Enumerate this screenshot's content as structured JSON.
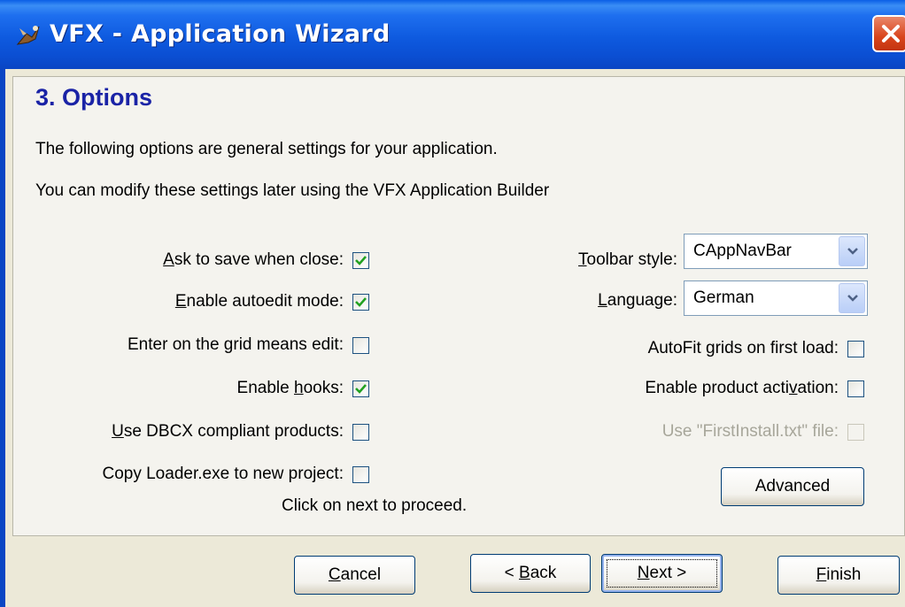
{
  "window": {
    "title": "VFX - Application Wizard"
  },
  "page": {
    "heading": "3. Options",
    "intro1": "The following options are general settings for your application.",
    "intro2": "You can modify these settings later using the VFX Application Builder",
    "footer_hint": "Click on next to proceed."
  },
  "left_options": [
    {
      "pre": "",
      "key": "A",
      "post": "sk to save when close:",
      "checked": true
    },
    {
      "pre": "",
      "key": "E",
      "post": "nable autoedit mode:",
      "checked": true
    },
    {
      "pre": "Enter on the ",
      "key": "g",
      "post": "rid means edit:",
      "checked": false
    },
    {
      "pre": "Enable ",
      "key": "h",
      "post": "ooks:",
      "checked": true
    },
    {
      "pre": "",
      "key": "U",
      "post": "se DBCX compliant products:",
      "checked": false
    },
    {
      "pre": "",
      "key": "",
      "post": "Copy Loader.exe to new project:",
      "checked": false
    }
  ],
  "right_options": {
    "toolbar_style": {
      "key": "T",
      "post": "oolbar style:",
      "value": "CAppNavBar"
    },
    "language": {
      "key": "L",
      "post": "anguage:",
      "value": "German"
    },
    "autofit": {
      "label": "AutoFit  grids on first load:",
      "checked": false
    },
    "activation": {
      "label": "Enable  product acti",
      "key": "v",
      "post": "ation:",
      "checked": false
    },
    "firstinstall": {
      "label": "Use \"FirstInstall.txt\" file:",
      "checked": false,
      "disabled": true
    }
  },
  "buttons": {
    "advanced": "Advanced",
    "cancel": {
      "key": "C",
      "post": "ancel"
    },
    "back": {
      "pre": "< ",
      "key": "B",
      "post": "ack"
    },
    "next": {
      "key": "N",
      "post": "ext >"
    },
    "finish": {
      "key": "F",
      "post": "inish"
    }
  },
  "colors": {
    "title_bar": "#0A46C4",
    "heading": "#1A23A6",
    "checkmark": "#21A121",
    "close_button": "#D9441C"
  }
}
